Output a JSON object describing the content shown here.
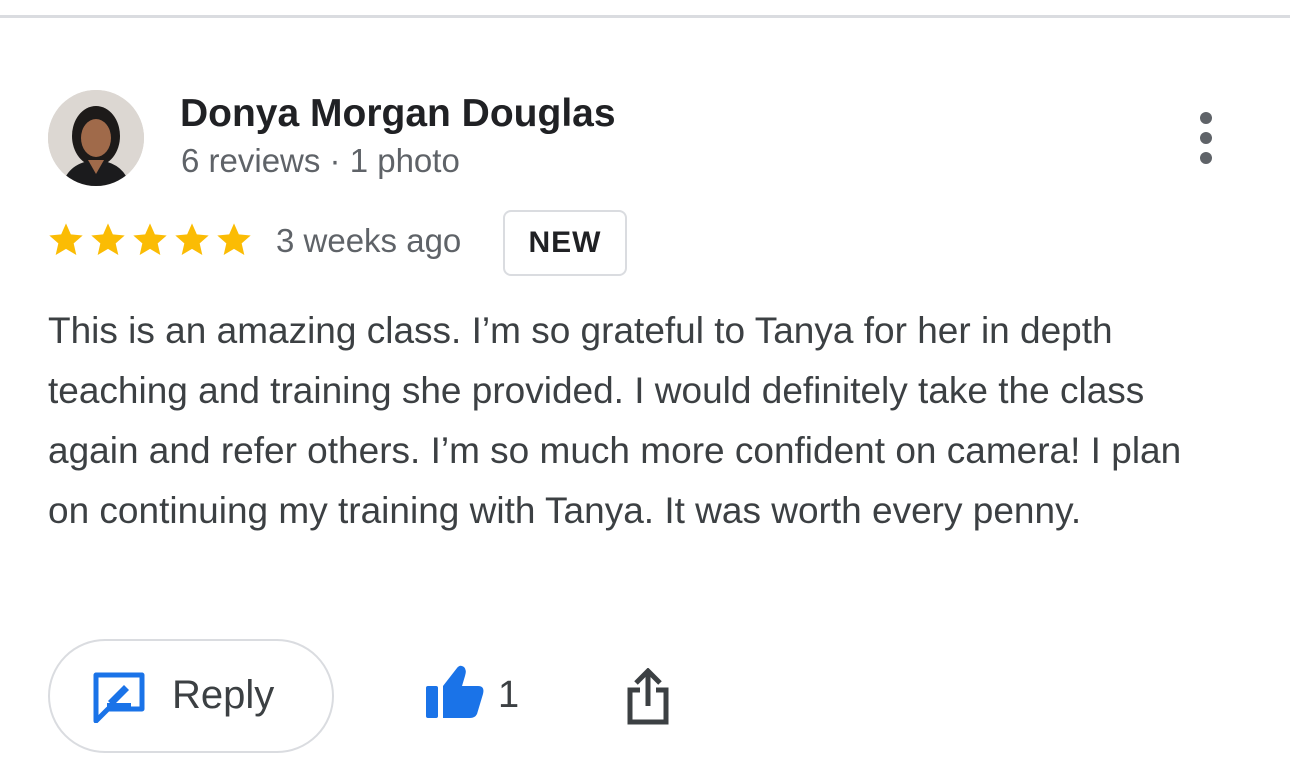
{
  "reviewer": {
    "name": "Donya Morgan Douglas",
    "meta": "6 reviews · 1 photo"
  },
  "review": {
    "rating": 5,
    "rating_max": 5,
    "time_ago": "3 weeks ago",
    "badge": "NEW",
    "text": "This is an amazing class. I’m so grateful to Tanya for her in depth teaching and training she provided. I would definitely take the class again and refer others. I’m so much more confident on camera! I plan on continuing my training with Tanya. It was worth every penny."
  },
  "actions": {
    "reply_label": "Reply",
    "like_count": "1"
  },
  "colors": {
    "star": "#fbbc04",
    "accent_blue": "#1a73e8",
    "divider": "#dadce0",
    "secondary_text": "#5f6368"
  },
  "icons": {
    "more": "more-vertical-icon",
    "star": "star-icon",
    "reply": "reply-icon",
    "like": "thumbs-up-icon",
    "share": "share-icon"
  }
}
